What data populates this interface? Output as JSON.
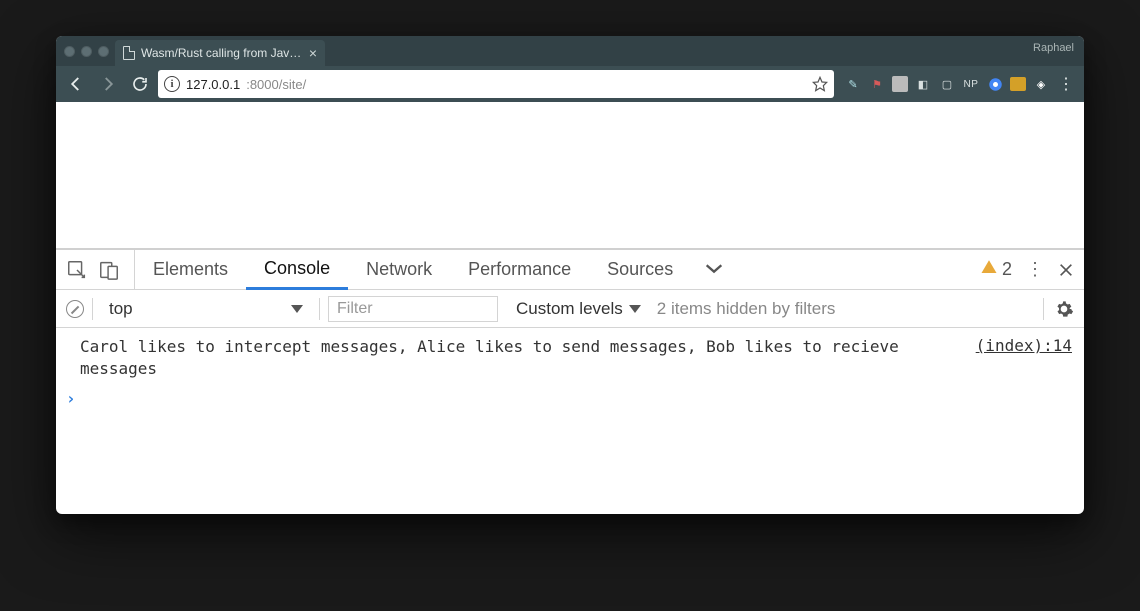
{
  "titlebar": {
    "tab_title": "Wasm/Rust calling from JavaS",
    "profile_name": "Raphael"
  },
  "toolbar": {
    "url_host": "127.0.0.1",
    "url_port_path": ":8000/site/",
    "extensions": [
      "pencil",
      "autofill",
      "power",
      "block",
      "page",
      "NP",
      "chrome",
      "minus",
      "cube"
    ]
  },
  "devtools": {
    "tabs": [
      "Elements",
      "Console",
      "Network",
      "Performance",
      "Sources"
    ],
    "active_tab": "Console",
    "warning_count": "2",
    "toolbar": {
      "context": "top",
      "filter_placeholder": "Filter",
      "levels_label": "Custom levels",
      "hidden_message": "2 items hidden by filters"
    },
    "console": {
      "message": "Carol likes to intercept messages, Alice likes to send messages, Bob likes to recieve messages",
      "source": "(index):14"
    }
  }
}
